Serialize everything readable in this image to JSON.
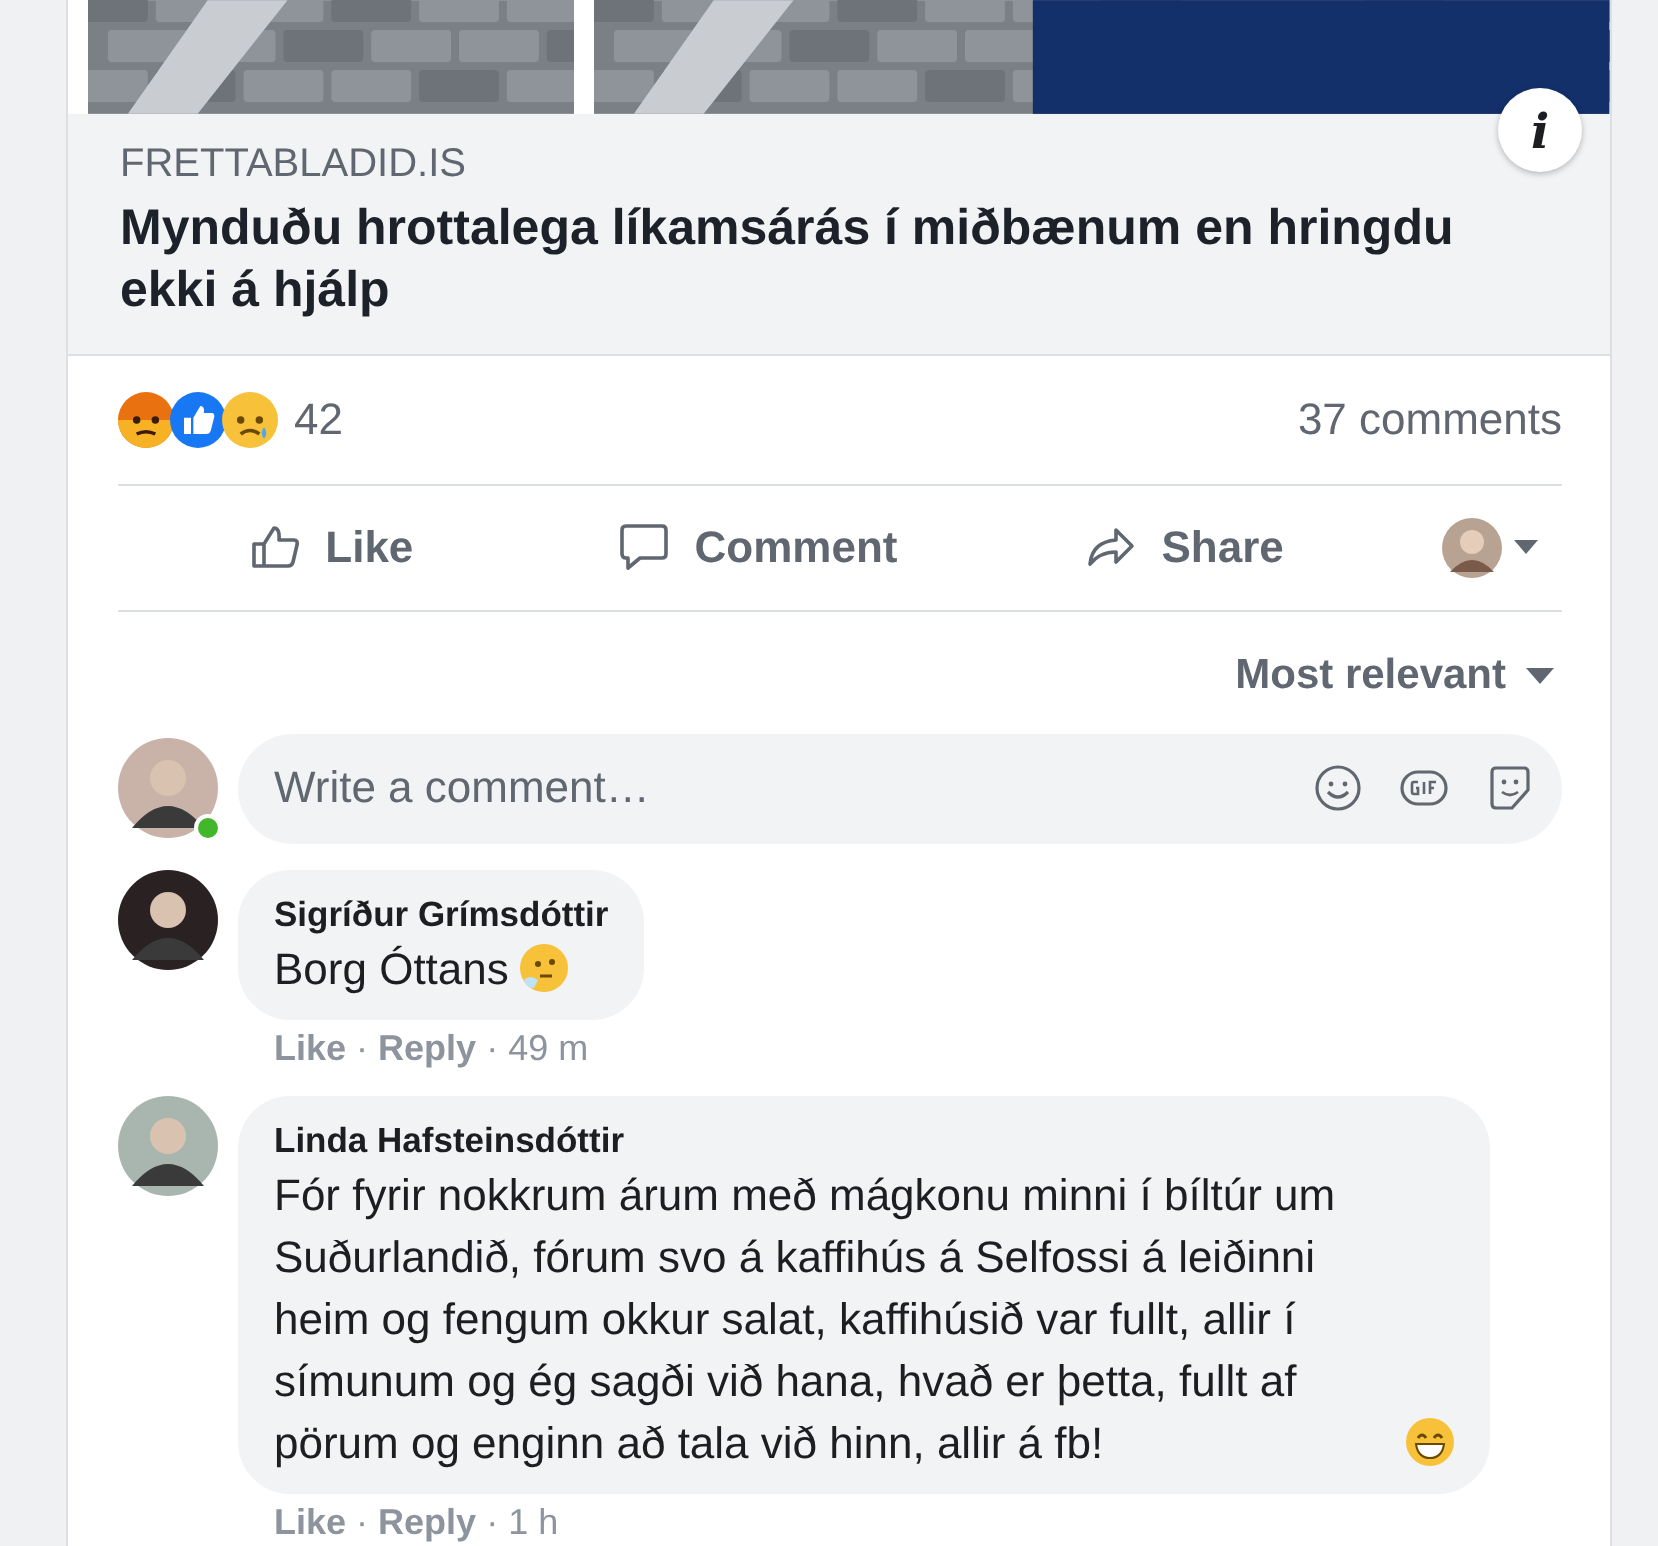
{
  "link_preview": {
    "info_button": "i",
    "domain": "FRETTABLADID.IS",
    "title": "Mynduðu hrottalega líkamsárás í miðbænum en hringdu ekki á hjálp"
  },
  "reactions": {
    "icons": [
      {
        "kind": "angry"
      },
      {
        "kind": "like"
      },
      {
        "kind": "sad"
      }
    ],
    "count": "42",
    "comments": "37 comments"
  },
  "actions": [
    {
      "kind": "like",
      "label": "Like"
    },
    {
      "kind": "comment",
      "label": "Comment"
    },
    {
      "kind": "share",
      "label": "Share"
    }
  ],
  "sort": "Most relevant",
  "composer": {
    "placeholder": "Write a comment…",
    "online": true
  },
  "comments": [
    {
      "author": "Sigríður Grímsdóttir",
      "text": "Borg Óttans",
      "emoji": {
        "kind": "thinking"
      },
      "meta": [
        {
          "kind": "link",
          "text": "Like"
        },
        {
          "kind": "sep",
          "text": "·"
        },
        {
          "kind": "link",
          "text": "Reply"
        },
        {
          "kind": "sep",
          "text": "·"
        },
        {
          "kind": "time",
          "text": "49 m"
        }
      ]
    },
    {
      "author": "Linda Hafsteinsdóttir",
      "text": "Fór fyrir nokkrum árum með mágkonu minni í bíltúr um Suðurlandið, fórum svo á kaffihús á Selfossi á leiðinni heim og fengum okkur salat, kaffihúsið var fullt, allir í símunum og ég sagði við hana, hvað er þetta, fullt af pörum og enginn að tala við hinn, allir á fb!",
      "emoji": {
        "kind": "grin"
      },
      "meta": [
        {
          "kind": "link",
          "text": "Like"
        },
        {
          "kind": "sep",
          "text": "·"
        },
        {
          "kind": "link",
          "text": "Reply"
        },
        {
          "kind": "sep",
          "text": "·"
        },
        {
          "kind": "time",
          "text": "1 h"
        }
      ]
    }
  ]
}
